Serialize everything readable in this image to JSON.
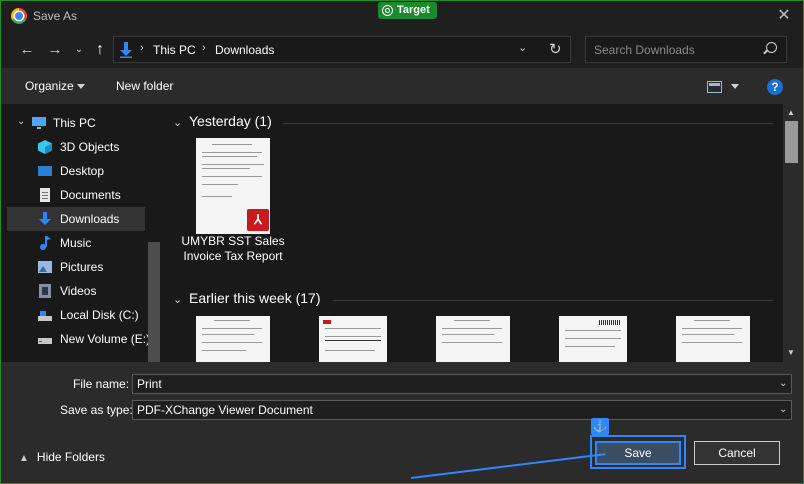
{
  "window": {
    "title": "Save As",
    "badge": "Target"
  },
  "nav": {
    "breadcrumbs": [
      "This PC",
      "Downloads"
    ],
    "search_placeholder": "Search Downloads"
  },
  "toolbar": {
    "organize": "Organize",
    "new_folder": "New folder"
  },
  "sidebar": {
    "items": [
      {
        "label": "This PC",
        "icon": "monitor-icon"
      },
      {
        "label": "3D Objects",
        "icon": "cube-icon"
      },
      {
        "label": "Desktop",
        "icon": "desktop-icon"
      },
      {
        "label": "Documents",
        "icon": "document-icon"
      },
      {
        "label": "Downloads",
        "icon": "download-icon"
      },
      {
        "label": "Music",
        "icon": "music-icon"
      },
      {
        "label": "Pictures",
        "icon": "pictures-icon"
      },
      {
        "label": "Videos",
        "icon": "videos-icon"
      },
      {
        "label": "Local Disk (C:)",
        "icon": "disk-icon"
      },
      {
        "label": "New Volume (E:)",
        "icon": "disk-icon"
      }
    ]
  },
  "content": {
    "groups": [
      {
        "label": "Yesterday (1)",
        "files": [
          {
            "name": "UMYBR SST Sales Invoice Tax Report",
            "icon": "pdf-icon"
          }
        ]
      },
      {
        "label": "Earlier this week (17)"
      }
    ]
  },
  "fields": {
    "file_name_label": "File name:",
    "file_name_value": "Print",
    "save_type_label": "Save as type:",
    "save_type_value": "PDF-XChange Viewer Document"
  },
  "footer": {
    "hide_folders": "Hide Folders",
    "save": "Save",
    "cancel": "Cancel"
  },
  "colors": {
    "accent": "#2f86ff",
    "window_border": "#1e8f2a",
    "pdf_red": "#c8191f"
  }
}
